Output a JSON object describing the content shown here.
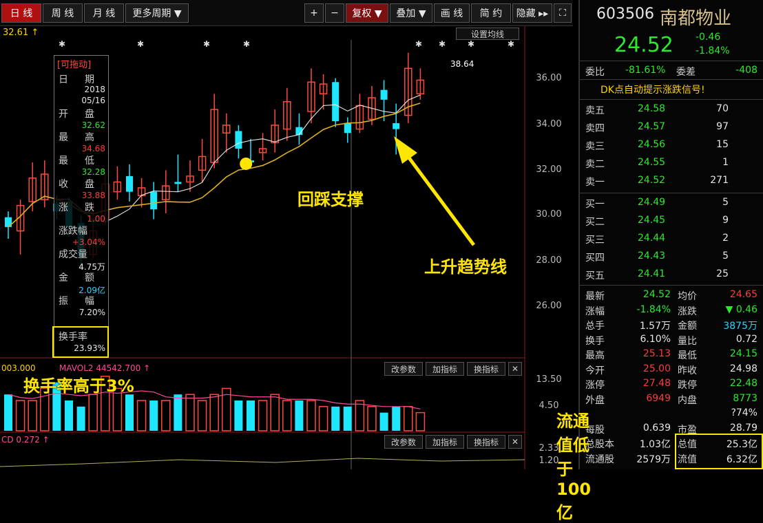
{
  "toolbar": {
    "daily": "日 线",
    "weekly": "周 线",
    "monthly": "月 线",
    "more_periods": "更多周期 ▼",
    "zoom_in": "+",
    "zoom_out": "−",
    "adjust": "复权 ▼",
    "overlay": "叠加 ▼",
    "draw_line": "画 线",
    "short_about": "简 约",
    "hide": "隐藏 ▸▸"
  },
  "chart": {
    "top_price_label": "32.61 ↑",
    "setting_ma": "设置均线",
    "peak_label": "38.64",
    "y_ticks": [
      "36.00",
      "34.00",
      "32.00",
      "30.00",
      "28.00",
      "26.00"
    ],
    "vol_ticks": [
      "13.50",
      "4.50",
      "2.33",
      "1.20"
    ],
    "vol_header": "003.000",
    "vol_ma": "MAVOL2  44542.700 ↑",
    "macd_header": "CD  0.272 ↑",
    "btn_indicator_change": "改参数",
    "btn_add_indicator": "加指标",
    "btn_switch_indicator": "换指标",
    "btn_close": "✕",
    "annotation_pullback": "回踩支撑",
    "annotation_trend": "上升趋势线",
    "annotation_turnover": "换手率高于3%",
    "annotation_float": "流通值低于100亿",
    "candles": [
      {
        "o": 29.3,
        "c": 28.8,
        "h": 29.6,
        "l": 28.2
      },
      {
        "o": 28.6,
        "c": 29.9,
        "h": 30.2,
        "l": 27.4
      },
      {
        "o": 30.1,
        "c": 31.3,
        "h": 32.1,
        "l": 29.6
      },
      {
        "o": 30.2,
        "c": 31.5,
        "h": 32.2,
        "l": 29.8
      },
      {
        "o": 30.0,
        "c": 29.6,
        "h": 30.4,
        "l": 29.2
      },
      {
        "o": 30.1,
        "c": 28.8,
        "h": 30.3,
        "l": 28.3
      },
      {
        "o": 29.0,
        "c": 27.3,
        "h": 29.4,
        "l": 26.6
      },
      {
        "o": 27.4,
        "c": 28.6,
        "h": 30.1,
        "l": 27.2
      },
      {
        "o": 29.2,
        "c": 31.0,
        "h": 31.6,
        "l": 28.9
      },
      {
        "o": 30.6,
        "c": 31.1,
        "h": 31.9,
        "l": 30.2
      },
      {
        "o": 31.4,
        "c": 30.6,
        "h": 32.0,
        "l": 30.1
      },
      {
        "o": 30.4,
        "c": 30.8,
        "h": 31.3,
        "l": 29.8
      },
      {
        "o": 30.6,
        "c": 29.7,
        "h": 31.1,
        "l": 29.2
      },
      {
        "o": 30.2,
        "c": 30.9,
        "h": 31.7,
        "l": 29.5
      },
      {
        "o": 31.1,
        "c": 31.0,
        "h": 32.5,
        "l": 30.6
      },
      {
        "o": 31.1,
        "c": 31.4,
        "h": 32.2,
        "l": 30.6
      },
      {
        "o": 31.7,
        "c": 32.4,
        "h": 33.3,
        "l": 31.1
      },
      {
        "o": 32.1,
        "c": 34.8,
        "h": 35.6,
        "l": 31.8
      },
      {
        "o": 33.6,
        "c": 34.0,
        "h": 34.6,
        "l": 32.6
      },
      {
        "o": 33.7,
        "c": 32.8,
        "h": 34.0,
        "l": 32.3
      },
      {
        "o": 32.2,
        "c": 32.1,
        "h": 33.3,
        "l": 31.8
      },
      {
        "o": 32.6,
        "c": 32.8,
        "h": 33.6,
        "l": 32.2
      },
      {
        "o": 33.1,
        "c": 34.0,
        "h": 34.8,
        "l": 32.6
      },
      {
        "o": 33.8,
        "c": 35.2,
        "h": 35.9,
        "l": 33.2
      },
      {
        "o": 33.9,
        "c": 33.5,
        "h": 34.6,
        "l": 33.0
      },
      {
        "o": 34.7,
        "c": 36.2,
        "h": 36.9,
        "l": 34.1
      },
      {
        "o": 35.6,
        "c": 36.1,
        "h": 36.6,
        "l": 34.8
      },
      {
        "o": 36.2,
        "c": 34.2,
        "h": 36.4,
        "l": 33.9
      },
      {
        "o": 34.1,
        "c": 33.6,
        "h": 34.4,
        "l": 33.1
      },
      {
        "o": 33.8,
        "c": 35.0,
        "h": 35.6,
        "l": 33.6
      },
      {
        "o": 34.3,
        "c": 35.4,
        "h": 36.0,
        "l": 34.0
      },
      {
        "o": 35.8,
        "c": 35.3,
        "h": 36.3,
        "l": 34.2
      },
      {
        "o": 34.1,
        "c": 33.8,
        "h": 35.1,
        "l": 32.5
      },
      {
        "o": 34.5,
        "c": 36.9,
        "h": 37.7,
        "l": 34.1
      },
      {
        "o": 35.6,
        "c": 36.3,
        "h": 36.9,
        "l": 35.3
      }
    ],
    "volumes": [
      6,
      5,
      5,
      7,
      8,
      5,
      4,
      6,
      9,
      7,
      6,
      5,
      5,
      5,
      6,
      6,
      5,
      6,
      7,
      5,
      5,
      5,
      6,
      5,
      5,
      5,
      4,
      4,
      4,
      5,
      4,
      3,
      4,
      4,
      3
    ]
  },
  "tooltip": {
    "title": "[可拖动]",
    "date_label": "日",
    "date_label2": "期",
    "date_year": "2018",
    "date_md": "05/16",
    "open_label1": "开",
    "open_label2": "盘",
    "open_value": "32.62",
    "high_label1": "最",
    "high_label2": "高",
    "high_value": "34.68",
    "low_label1": "最",
    "low_label2": "低",
    "low_value": "32.28",
    "close_label1": "收",
    "close_label2": "盘",
    "close_value": "33.88",
    "change_label1": "涨",
    "change_label2": "跌",
    "change_value": "1.00",
    "pct_label": "涨跌幅",
    "pct_value": "+3.04%",
    "vol_label": "成交量",
    "vol_value": "4.75万",
    "amount_label1": "金",
    "amount_label2": "额",
    "amount_value": "2.09亿",
    "amp_label1": "振",
    "amp_label2": "幅",
    "amp_value": "7.20%",
    "turnover_label": "换手率",
    "turnover_value": "23.93%"
  },
  "quote": {
    "code": "603506",
    "name": "南都物业",
    "price": "24.52",
    "change": "-0.46",
    "change_pct": "-1.84%",
    "wei_bi_label": "委比",
    "wei_bi": "-81.61%",
    "wei_cha_label": "委差",
    "wei_cha": "-408",
    "signal_banner": "DK点自动提示涨跌信号!",
    "asks": [
      {
        "label": "卖五",
        "price": "24.58",
        "vol": "70"
      },
      {
        "label": "卖四",
        "price": "24.57",
        "vol": "97"
      },
      {
        "label": "卖三",
        "price": "24.56",
        "vol": "15"
      },
      {
        "label": "卖二",
        "price": "24.55",
        "vol": "1"
      },
      {
        "label": "卖一",
        "price": "24.52",
        "vol": "271"
      }
    ],
    "bids": [
      {
        "label": "买一",
        "price": "24.49",
        "vol": "5"
      },
      {
        "label": "买二",
        "price": "24.45",
        "vol": "9"
      },
      {
        "label": "买三",
        "price": "24.44",
        "vol": "2"
      },
      {
        "label": "买四",
        "price": "24.43",
        "vol": "5"
      },
      {
        "label": "买五",
        "price": "24.41",
        "vol": "25"
      }
    ],
    "stats": [
      {
        "l1": "最新",
        "v1": "24.52",
        "c1": "green",
        "l2": "均价",
        "v2": "24.65",
        "c2": "red"
      },
      {
        "l1": "涨幅",
        "v1": "-1.84%",
        "c1": "green",
        "l2": "涨跌",
        "v2": "▼ 0.46",
        "c2": "green"
      },
      {
        "l1": "总手",
        "v1": "1.57万",
        "c1": "white",
        "l2": "金额",
        "v2": "3875万",
        "c2": "cyan"
      },
      {
        "l1": "换手",
        "v1": "6.10%",
        "c1": "white",
        "l2": "量比",
        "v2": "0.72",
        "c2": "white"
      },
      {
        "l1": "最高",
        "v1": "25.13",
        "c1": "red",
        "l2": "最低",
        "v2": "24.15",
        "c2": "green"
      },
      {
        "l1": "今开",
        "v1": "25.00",
        "c1": "red",
        "l2": "昨收",
        "v2": "24.98",
        "c2": "white"
      },
      {
        "l1": "涨停",
        "v1": "27.48",
        "c1": "red",
        "l2": "跌停",
        "v2": "22.48",
        "c2": "green"
      },
      {
        "l1": "外盘",
        "v1": "6949",
        "c1": "red",
        "l2": "内盘",
        "v2": "8773",
        "c2": "green"
      },
      {
        "l1": "",
        "v1": "",
        "c1": "white",
        "l2": "",
        "v2": "?74%",
        "c2": "white"
      },
      {
        "l1": "每股",
        "v1": "0.639",
        "c1": "white",
        "l2": "市盈",
        "v2": "28.79",
        "c2": "white"
      },
      {
        "l1": "总股本",
        "v1": "1.03亿",
        "c1": "white",
        "l2": "总值",
        "v2": "25.3亿",
        "c2": "white"
      },
      {
        "l1": "流通股",
        "v1": "2579万",
        "c1": "white",
        "l2": "流值",
        "v2": "6.32亿",
        "c2": "white"
      }
    ]
  },
  "colors": {
    "up": "#ff4a3d",
    "down": "#1ee6ff",
    "ma_short": "#ffffff",
    "ma_long": "#e0b020",
    "annotation": "#ffe600"
  }
}
